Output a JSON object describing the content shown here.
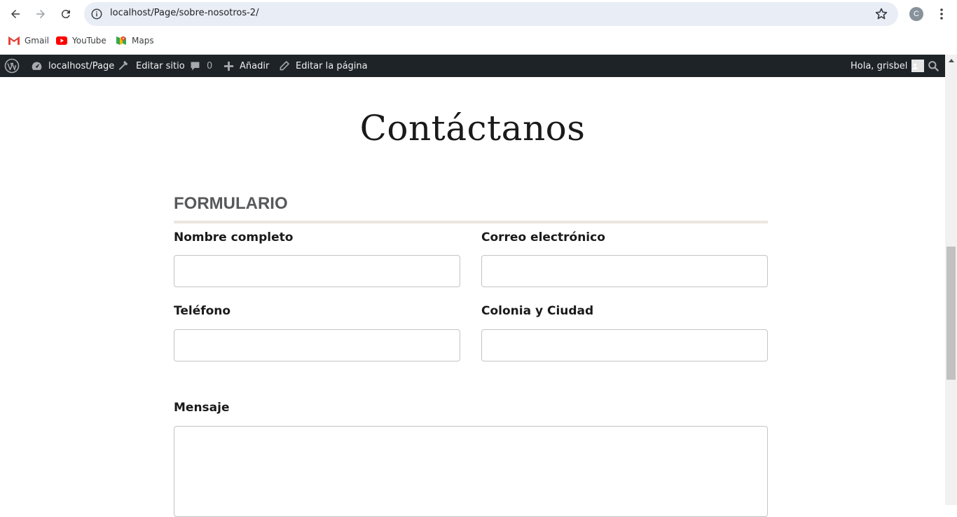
{
  "browser": {
    "url": "localhost/Page/sobre-nosotros-2/",
    "profile_initial": "C",
    "bookmarks": [
      {
        "label": "Gmail",
        "icon": "gmail-icon"
      },
      {
        "label": "YouTube",
        "icon": "youtube-icon"
      },
      {
        "label": "Maps",
        "icon": "maps-icon"
      }
    ]
  },
  "adminbar": {
    "site_name": "localhost/Page",
    "edit_site": "Editar sitio",
    "comments_count": "0",
    "add_new": "Añadir",
    "edit_page": "Editar la página",
    "greeting": "Hola, grisbel"
  },
  "page": {
    "title": "Contáctanos",
    "section_heading": "FORMULARIO",
    "fields": {
      "name_label": "Nombre completo",
      "email_label": "Correo electrónico",
      "phone_label": "Teléfono",
      "location_label": "Colonia y Ciudad",
      "message_label": "Mensaje",
      "name_value": "",
      "email_value": "",
      "phone_value": "",
      "location_value": ""
    }
  },
  "colors": {
    "adminbar_bg": "#1d2327",
    "heading": "#58595b",
    "rule": "#ece6df",
    "omnibox_bg": "#e9edf6"
  }
}
